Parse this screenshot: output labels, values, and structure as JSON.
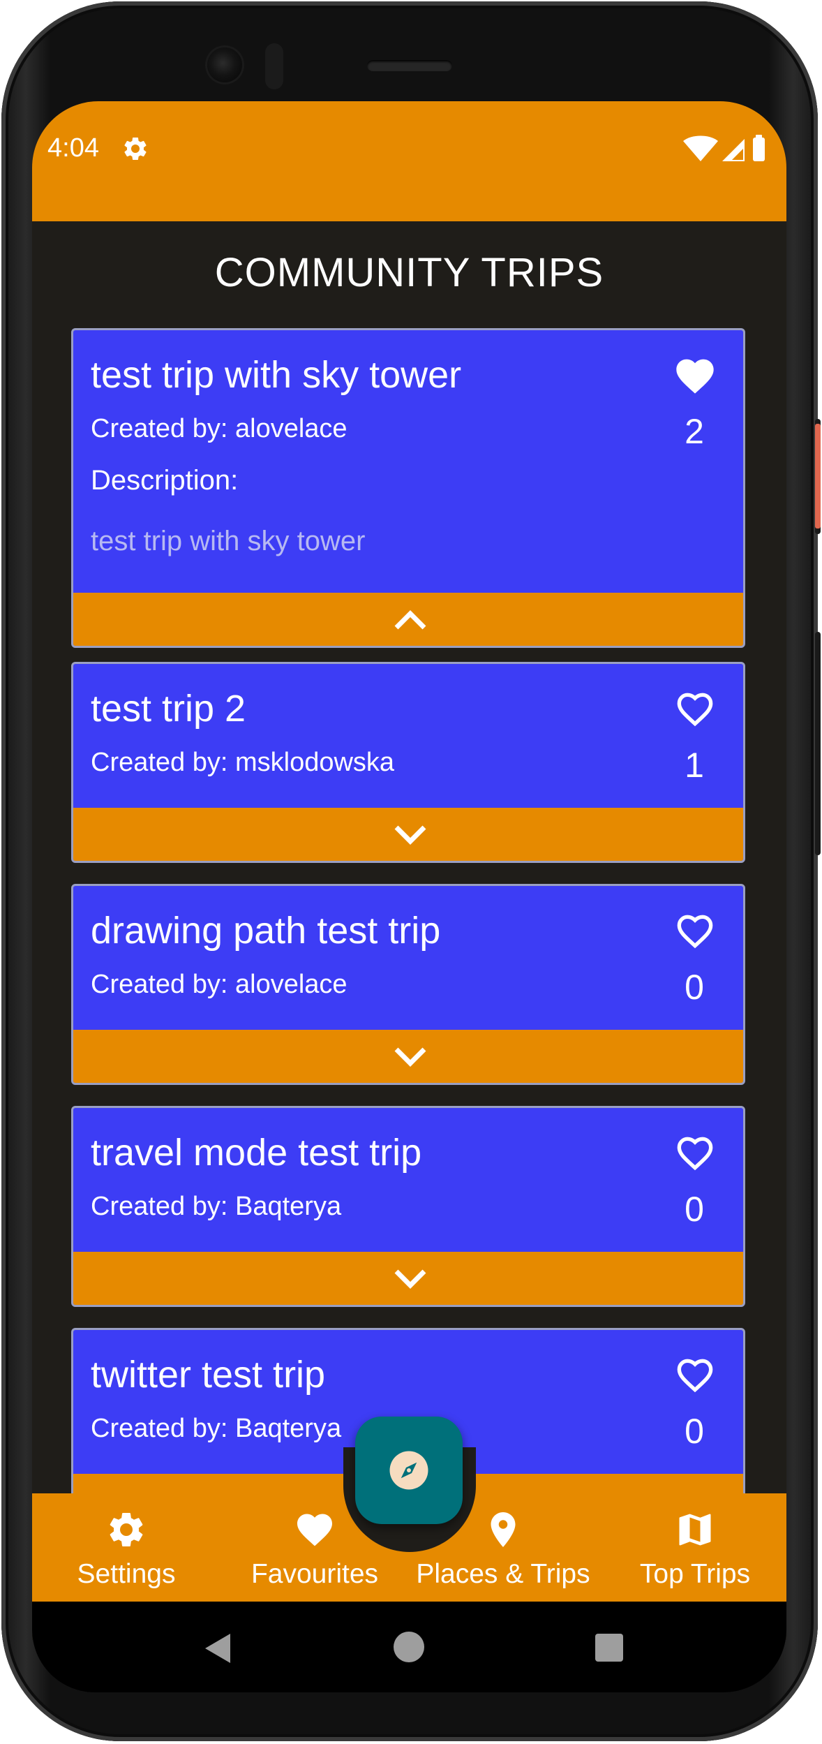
{
  "status_bar": {
    "time": "4:04"
  },
  "page_title": "COMMUNITY TRIPS",
  "trips": [
    {
      "title": "test trip with sky tower",
      "creator": "Created by: alovelace",
      "likes": "2",
      "liked": true,
      "expanded": true,
      "description_label": "Description:",
      "description": "test trip with sky tower"
    },
    {
      "title": "test trip 2",
      "creator": "Created by: msklodowska",
      "likes": "1",
      "liked": false,
      "expanded": false
    },
    {
      "title": "drawing path test trip",
      "creator": "Created by: alovelace",
      "likes": "0",
      "liked": false,
      "expanded": false
    },
    {
      "title": "travel mode test trip",
      "creator": "Created by: Baqterya",
      "likes": "0",
      "liked": false,
      "expanded": false
    },
    {
      "title": "twitter test trip",
      "creator": "Created by: Baqterya",
      "likes": "0",
      "liked": false,
      "expanded": false
    }
  ],
  "bottom_nav": [
    {
      "label": "Settings",
      "icon": "gear-icon"
    },
    {
      "label": "Favourites",
      "icon": "heart-icon"
    },
    {
      "label": "Places & Trips",
      "icon": "map-pin-icon"
    },
    {
      "label": "Top Trips",
      "icon": "map-icon"
    }
  ],
  "fab": {
    "icon": "compass-icon"
  },
  "colors": {
    "accent": "#e68a00",
    "card": "#3d3df5",
    "background": "#1f1d19",
    "fab": "#00707a"
  }
}
